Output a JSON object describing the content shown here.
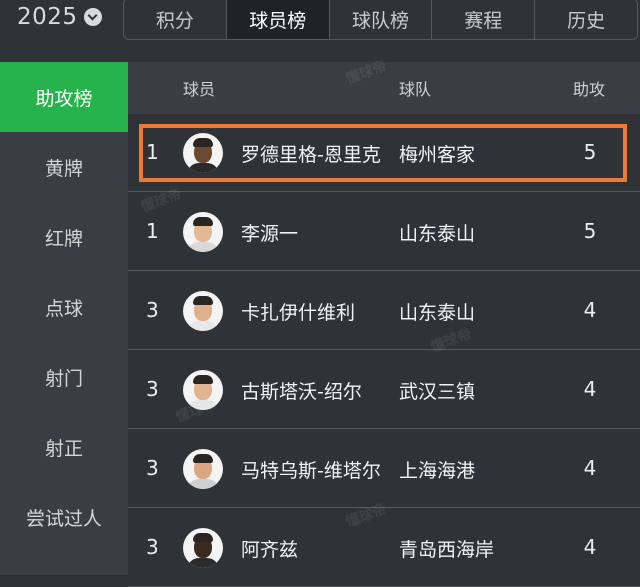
{
  "season": {
    "label": "2025"
  },
  "tabs": [
    {
      "label": "积分",
      "active": false
    },
    {
      "label": "球员榜",
      "active": true
    },
    {
      "label": "球队榜",
      "active": false
    },
    {
      "label": "赛程",
      "active": false
    },
    {
      "label": "历史",
      "active": false
    }
  ],
  "sidebar": {
    "items": [
      {
        "label": "助攻榜",
        "active": true
      },
      {
        "label": "黄牌",
        "active": false
      },
      {
        "label": "红牌",
        "active": false
      },
      {
        "label": "点球",
        "active": false
      },
      {
        "label": "射门",
        "active": false
      },
      {
        "label": "射正",
        "active": false
      },
      {
        "label": "尝试过人",
        "active": false
      }
    ]
  },
  "table": {
    "headers": {
      "player": "球员",
      "team": "球队",
      "assists": "助攻"
    },
    "rows": [
      {
        "rank": "1",
        "name": "罗德里格-恩里克",
        "team": "梅州客家",
        "assists": "5",
        "skin": "#6b4a33",
        "shirt": "#2a2a2a",
        "highlighted": true
      },
      {
        "rank": "1",
        "name": "李源一",
        "team": "山东泰山",
        "assists": "5",
        "skin": "#e3b895",
        "shirt": "#d9d9d9",
        "highlighted": false
      },
      {
        "rank": "3",
        "name": "卡扎伊什维利",
        "team": "山东泰山",
        "assists": "4",
        "skin": "#e0b08c",
        "shirt": "#e8e8e8",
        "highlighted": false
      },
      {
        "rank": "3",
        "name": "古斯塔沃-绍尔",
        "team": "武汉三镇",
        "assists": "4",
        "skin": "#e2b38f",
        "shirt": "#e6e6e6",
        "highlighted": false
      },
      {
        "rank": "3",
        "name": "马特乌斯-维塔尔",
        "team": "上海海港",
        "assists": "4",
        "skin": "#d9a883",
        "shirt": "#cfcfcf",
        "highlighted": false
      },
      {
        "rank": "3",
        "name": "阿齐兹",
        "team": "青岛西海岸",
        "assists": "4",
        "skin": "#3b2a20",
        "shirt": "#2b2b2b",
        "highlighted": false
      }
    ]
  },
  "colors": {
    "accent_green": "#27b34b",
    "highlight_orange": "#f07a35",
    "background": "#2f3338"
  },
  "watermark": "懂球帝"
}
